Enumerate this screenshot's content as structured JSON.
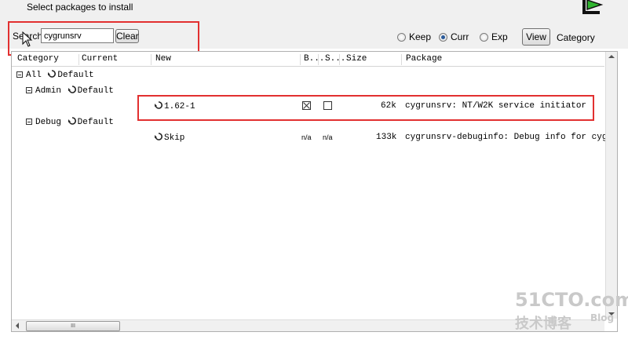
{
  "window": {
    "subtitle": "Select packages to install"
  },
  "search": {
    "label": "Search",
    "value": "cygrunsrv",
    "clear_label": "Clear"
  },
  "view_options": {
    "radios": [
      {
        "label": "Keep",
        "checked": false
      },
      {
        "label": "Curr",
        "checked": true
      },
      {
        "label": "Exp",
        "checked": false
      }
    ],
    "view_button": "View",
    "current_view": "Category"
  },
  "columns": [
    "Category",
    "Current",
    "New",
    "B...",
    "S...",
    "Size",
    "Package"
  ],
  "tree": [
    {
      "label": "All",
      "value": "Default"
    },
    {
      "label": "Admin",
      "value": "Default"
    },
    {
      "label": "Debug",
      "value": "Default"
    }
  ],
  "packages": [
    {
      "new": "1.62-1",
      "bin": "checked",
      "src": "unchecked",
      "size": "62k",
      "package": "cygrunsrv: NT/W2K service initiator"
    },
    {
      "new": "Skip",
      "bin": "n/a",
      "src": "n/a",
      "size": "133k",
      "package": "cygrunsrv-debuginfo: Debug info for cygr"
    }
  ],
  "scrollbar": {
    "grip": "III"
  },
  "watermark": {
    "main": "51CTO.com",
    "sub": "技术博客",
    "blog": "Blog"
  },
  "colors": {
    "highlight": "#e23030",
    "window_bg": "#f0f0f0"
  }
}
